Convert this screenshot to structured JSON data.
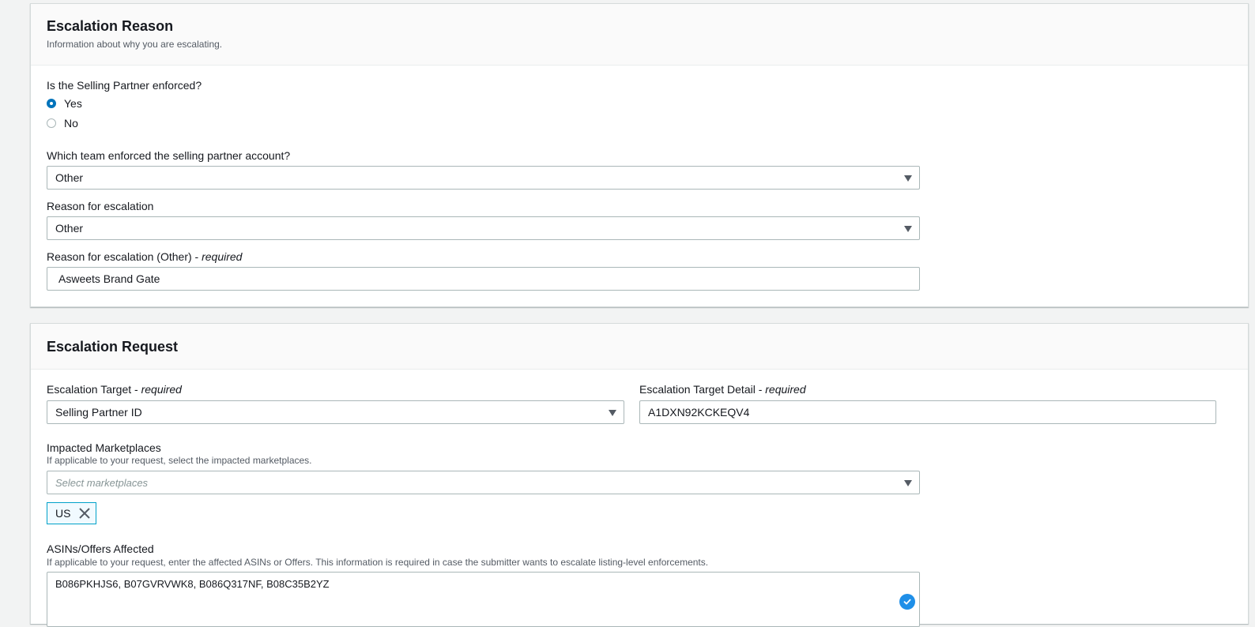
{
  "reason_section": {
    "title": "Escalation Reason",
    "description": "Information about why you are escalating.",
    "enforced_question": "Is the Selling Partner enforced?",
    "enforced_options": [
      {
        "label": "Yes",
        "checked": true
      },
      {
        "label": "No",
        "checked": false
      }
    ],
    "team_label": "Which team enforced the selling partner account?",
    "team_value": "Other",
    "reason_label": "Reason for escalation",
    "reason_value": "Other",
    "other_label": "Reason for escalation (Other) - ",
    "other_required": "required",
    "other_value": "Asweets Brand Gate"
  },
  "request_section": {
    "title": "Escalation Request",
    "target_label": "Escalation Target - ",
    "target_required": "required",
    "target_value": "Selling Partner ID",
    "target_detail_label": "Escalation Target Detail - ",
    "target_detail_required": "required",
    "target_detail_value": "A1DXN92KCKEQV4",
    "marketplaces_label": "Impacted Marketplaces",
    "marketplaces_hint": "If applicable to your request, select the impacted marketplaces.",
    "marketplaces_placeholder": "Select marketplaces",
    "marketplace_tokens": [
      "US"
    ],
    "asins_label": "ASINs/Offers Affected",
    "asins_hint": "If applicable to your request, enter the affected ASINs or Offers. This information is required in case the submitter wants to escalate listing-level enforcements.",
    "asins_value": "B086PKHJS6, B07GVRVWK8, B086Q317NF, B08C35B2YZ"
  },
  "colors": {
    "accent": "#0073bb",
    "token_border": "#00a1c9",
    "badge": "#1f8fe8"
  }
}
